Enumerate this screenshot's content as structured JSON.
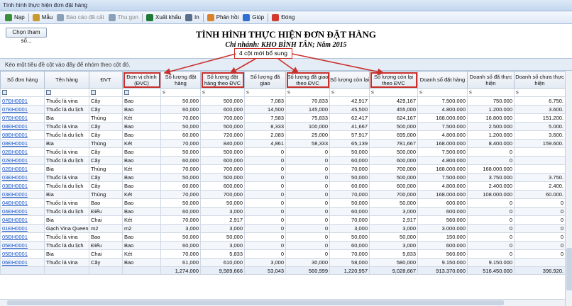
{
  "window": {
    "title": "Tình hình thực hiện đơn đặt hàng"
  },
  "toolbar": {
    "items": [
      {
        "label": "Nạp",
        "icon": "refresh-icon",
        "color": "#3b8f3b",
        "disabled": false
      },
      {
        "label": "Mẫu",
        "icon": "template-icon",
        "color": "#c99a2e",
        "disabled": false
      },
      {
        "label": "Báo cáo đã cất",
        "icon": "saved-report-icon",
        "color": "#8aa0b8",
        "disabled": true
      },
      {
        "label": "Thu gọn",
        "icon": "collapse-icon",
        "color": "#8aa0b8",
        "disabled": true
      },
      {
        "label": "Xuất khẩu",
        "icon": "excel-icon",
        "color": "#1f7a3a",
        "disabled": false
      },
      {
        "label": "In",
        "icon": "print-icon",
        "color": "#5a6f8c",
        "disabled": false
      },
      {
        "label": "Phản hồi",
        "icon": "feedback-icon",
        "color": "#d9822b",
        "disabled": false
      },
      {
        "label": "Giúp",
        "icon": "help-icon",
        "color": "#2f6fd1",
        "disabled": false
      },
      {
        "label": "Đóng",
        "icon": "close-icon",
        "color": "#d13b2f",
        "disabled": false
      }
    ]
  },
  "params_button": "Chọn tham số...",
  "report": {
    "title": "TÌNH HÌNH THỰC HIỆN ĐƠN ĐẶT HÀNG",
    "subtitle": "Chi nhánh: KHO BÌNH TÂN; Năm 2015"
  },
  "group_hint": "Kéo một tiêu đề cột vào đây để nhóm theo cột đó.",
  "callout": "4 cột mới bổ sung",
  "accent": "#c9302c",
  "columns": [
    "Số đơn hàng",
    "Tên hàng",
    "ĐVT",
    "Đơn vị chính (ĐVC)",
    "Số lượng đặt hàng",
    "Số lượng đặt hàng theo ĐVC",
    "Số lượng đã giao",
    "Số lượng đã giao theo ĐVC",
    "Số lượng còn lại",
    "Số lượng còn lại theo ĐVC",
    "Doanh số đặt hàng",
    "Doanh số đã thực hiện",
    "Doanh số chưa thực hiện"
  ],
  "rows": [
    [
      "07ĐH0001",
      "Thuốc lá vina",
      "Cây",
      "Bao",
      "50,000",
      "500,000",
      "7,083",
      "70,833",
      "42,917",
      "429,167",
      "7.500.000",
      "750.000",
      "6.750."
    ],
    [
      "07ĐH0001",
      "Thuốc lá du lịch",
      "Cây",
      "Bao",
      "60,000",
      "600,000",
      "14,500",
      "145,000",
      "45,500",
      "455,000",
      "4.800.000",
      "1.200.000",
      "3.600."
    ],
    [
      "07ĐH0001",
      "Bia",
      "Thùng",
      "Két",
      "70,000",
      "700,000",
      "7,583",
      "75,833",
      "62,417",
      "624,167",
      "168.000.000",
      "16.800.000",
      "151.200."
    ],
    [
      "08ĐH0001",
      "Thuốc lá vina",
      "Cây",
      "Bao",
      "50,000",
      "500,000",
      "8,333",
      "100,000",
      "41,667",
      "500,000",
      "7.500.000",
      "2.500.000",
      "5.000."
    ],
    [
      "08ĐH0001",
      "Thuốc lá du lịch",
      "Cây",
      "Bao",
      "60,000",
      "720,000",
      "2,083",
      "25,000",
      "57,917",
      "695,000",
      "4.800.000",
      "1.200.000",
      "3.600."
    ],
    [
      "08ĐH0001",
      "Bia",
      "Thùng",
      "Két",
      "70,000",
      "840,000",
      "4,861",
      "58,333",
      "65,139",
      "781,667",
      "168.000.000",
      "8.400.000",
      "159.600."
    ],
    [
      "02ĐH0001",
      "Thuốc lá vina",
      "Cây",
      "Bao",
      "50,000",
      "500,000",
      "0",
      "0",
      "50,000",
      "500,000",
      "7.500.000",
      "0",
      ""
    ],
    [
      "02ĐH0001",
      "Thuốc lá du lịch",
      "Cây",
      "Bao",
      "60,000",
      "600,000",
      "0",
      "0",
      "60,000",
      "600,000",
      "4.800.000",
      "0",
      ""
    ],
    [
      "02ĐH0001",
      "Bia",
      "Thùng",
      "Két",
      "70,000",
      "700,000",
      "0",
      "0",
      "70,000",
      "700,000",
      "168.000.000",
      "168.000.000",
      ""
    ],
    [
      "03ĐH0001",
      "Thuốc lá vina",
      "Cây",
      "Bao",
      "50,000",
      "500,000",
      "0",
      "0",
      "50,000",
      "500,000",
      "7.500.000",
      "3.750.000",
      "3.750."
    ],
    [
      "03ĐH0001",
      "Thuốc lá du lịch",
      "Cây",
      "Bao",
      "60,000",
      "600,000",
      "0",
      "0",
      "60,000",
      "600,000",
      "4.800.000",
      "2.400.000",
      "2.400."
    ],
    [
      "03ĐH0001",
      "Bia",
      "Thùng",
      "Két",
      "70,000",
      "700,000",
      "0",
      "0",
      "70,000",
      "700,000",
      "168.000.000",
      "108.000.000",
      "60.000."
    ],
    [
      "04ĐH0001",
      "Thuốc lá vina",
      "Bao",
      "Bao",
      "50,000",
      "50,000",
      "0",
      "0",
      "50,000",
      "50,000",
      "600.000",
      "0",
      "0"
    ],
    [
      "04ĐH0001",
      "Thuốc lá du lịch",
      "Điếu",
      "Bao",
      "60,000",
      "3,000",
      "0",
      "0",
      "60,000",
      "3,000",
      "600.000",
      "0",
      "0"
    ],
    [
      "04ĐH0001",
      "Bia",
      "Chai",
      "Két",
      "70,000",
      "2,917",
      "0",
      "0",
      "70,000",
      "2,917",
      "560.000",
      "0",
      "0"
    ],
    [
      "01ĐH0001",
      "Gạch Vina Queen",
      "m2",
      "m2",
      "3,000",
      "3,000",
      "0",
      "0",
      "3,000",
      "3,000",
      "3.000.000",
      "0",
      "0"
    ],
    [
      "05ĐH0001",
      "Thuốc lá vina",
      "Bao",
      "Bao",
      "50,000",
      "50,000",
      "0",
      "0",
      "50,000",
      "50,000",
      "150.000",
      "0",
      "0"
    ],
    [
      "05ĐH0001",
      "Thuốc lá du lịch",
      "Điếu",
      "Bao",
      "60,000",
      "3,000",
      "0",
      "0",
      "60,000",
      "3,000",
      "600.000",
      "0",
      "0"
    ],
    [
      "05ĐH0001",
      "Bia",
      "Chai",
      "Két",
      "70,000",
      "5,833",
      "0",
      "0",
      "70,000",
      "5,833",
      "560.000",
      "0",
      "0"
    ],
    [
      "06ĐH0001",
      "Thuốc lá vina",
      "Cây",
      "Bao",
      "61,000",
      "610,000",
      "3,000",
      "30,000",
      "58,000",
      "580,000",
      "9.150.000",
      "9.150.000",
      ""
    ]
  ],
  "totals": [
    "",
    "",
    "",
    "",
    "1,274,000",
    "9,589,666",
    "53,043",
    "560,999",
    "1,220,957",
    "9,028,667",
    "913.370.000",
    "516.450.000",
    "396.920."
  ]
}
